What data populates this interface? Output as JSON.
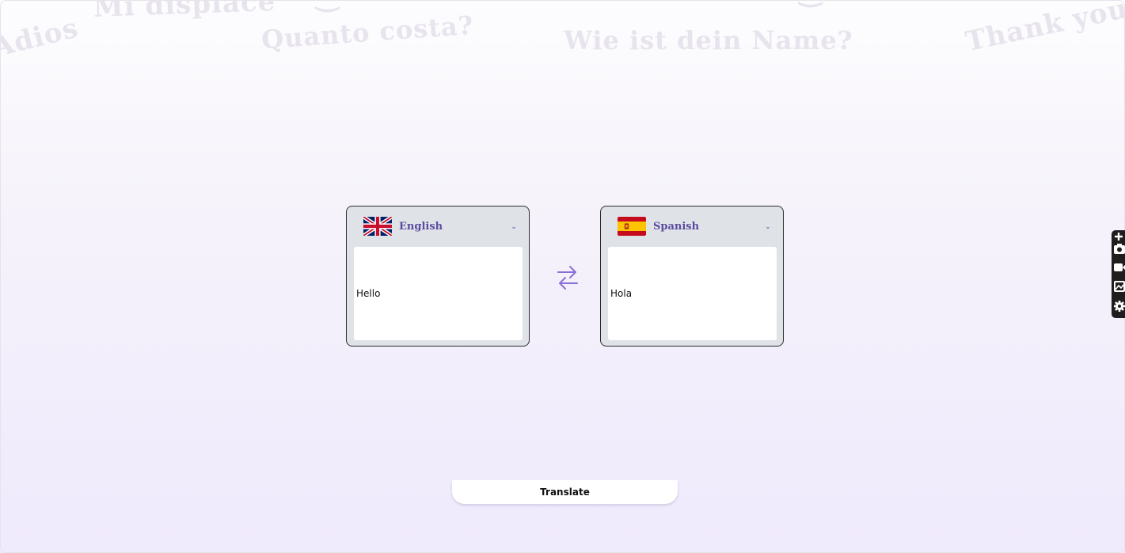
{
  "background_phrases": {
    "mi_displace": "Mi displace",
    "adios": "Adios",
    "quanto_costa": "Quanto costa?",
    "wie_ist_dein_name": "Wie ist dein Name?",
    "thank_you": "Thank you"
  },
  "source": {
    "language": "English",
    "flag_icon": "uk-flag-icon",
    "text": "Hello"
  },
  "target": {
    "language": "Spanish",
    "flag_icon": "spain-flag-icon",
    "text": "Hola"
  },
  "swap_icon": "swap-arrows-icon",
  "translate_button": {
    "label": "Translate"
  },
  "side_toolbar": {
    "icons": [
      "add-icon",
      "camera-icon",
      "video-icon",
      "image-icon",
      "settings-gear-icon"
    ]
  },
  "colors": {
    "accent": "#8b6fd8",
    "language_label": "#5b4a9e",
    "card_bg": "#dfe3e8"
  }
}
